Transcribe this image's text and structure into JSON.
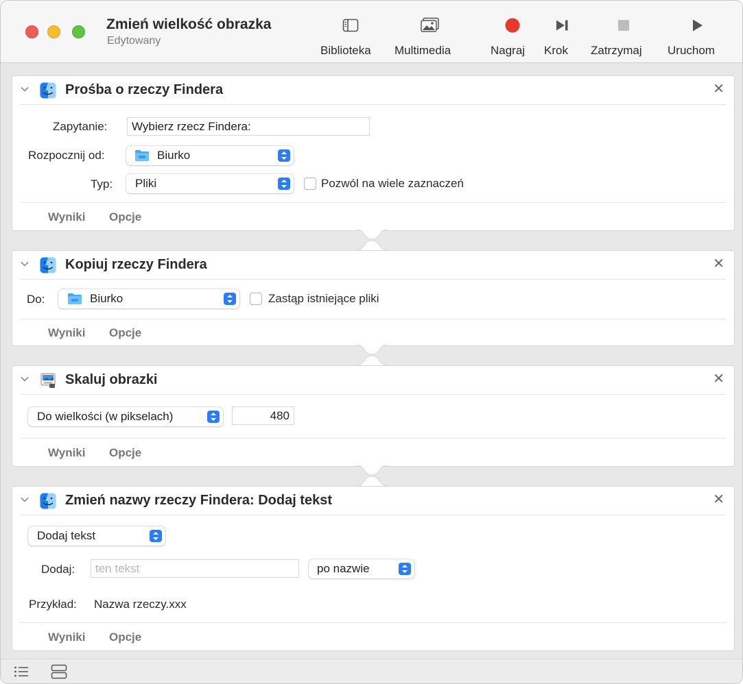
{
  "window": {
    "title": "Zmień wielkość obrazka",
    "subtitle": "Edytowany"
  },
  "toolbar": {
    "library": {
      "label": "Biblioteka",
      "icon": "sidebar-icon"
    },
    "media": {
      "label": "Multimedia",
      "icon": "photos-icon"
    },
    "record": {
      "label": "Nagraj",
      "icon": "record-icon",
      "color": "#e63a2e"
    },
    "step": {
      "label": "Krok",
      "icon": "step-icon"
    },
    "stop": {
      "label": "Zatrzymaj",
      "icon": "stop-icon",
      "disabled": true
    },
    "run": {
      "label": "Uruchom",
      "icon": "play-icon"
    }
  },
  "actions": [
    {
      "title": "Prośba o rzeczy Findera",
      "icon": "finder-icon",
      "prompt_label": "Zapytanie:",
      "prompt_value": "Wybierz rzecz Findera:",
      "start_label": "Rozpocznij od:",
      "start_value": "Biurko",
      "type_label": "Typ:",
      "type_value": "Pliki",
      "multi_label": "Pozwól na wiele zaznaczeń",
      "results": "Wyniki",
      "options": "Opcje"
    },
    {
      "title": "Kopiuj rzeczy Findera",
      "icon": "finder-icon",
      "to_label": "Do:",
      "to_value": "Biurko",
      "replace_label": "Zastąp istniejące pliki",
      "results": "Wyniki",
      "options": "Opcje"
    },
    {
      "title": "Skaluj obrazki",
      "icon": "preview-icon",
      "mode_value": "Do wielkości (w pikselach)",
      "size_value": "480",
      "results": "Wyniki",
      "options": "Opcje"
    },
    {
      "title": "Zmień nazwy rzeczy Findera: Dodaj tekst",
      "icon": "finder-icon",
      "mode_value": "Dodaj tekst",
      "add_label": "Dodaj:",
      "add_placeholder": "ten tekst",
      "position_value": "po nazwie",
      "example_label": "Przykład:",
      "example_value": "Nazwa rzeczy.xxx",
      "results": "Wyniki",
      "options": "Opcje"
    }
  ],
  "bottombar": {
    "list_icon": "list-icon",
    "flow_icon": "workflow-icon"
  }
}
